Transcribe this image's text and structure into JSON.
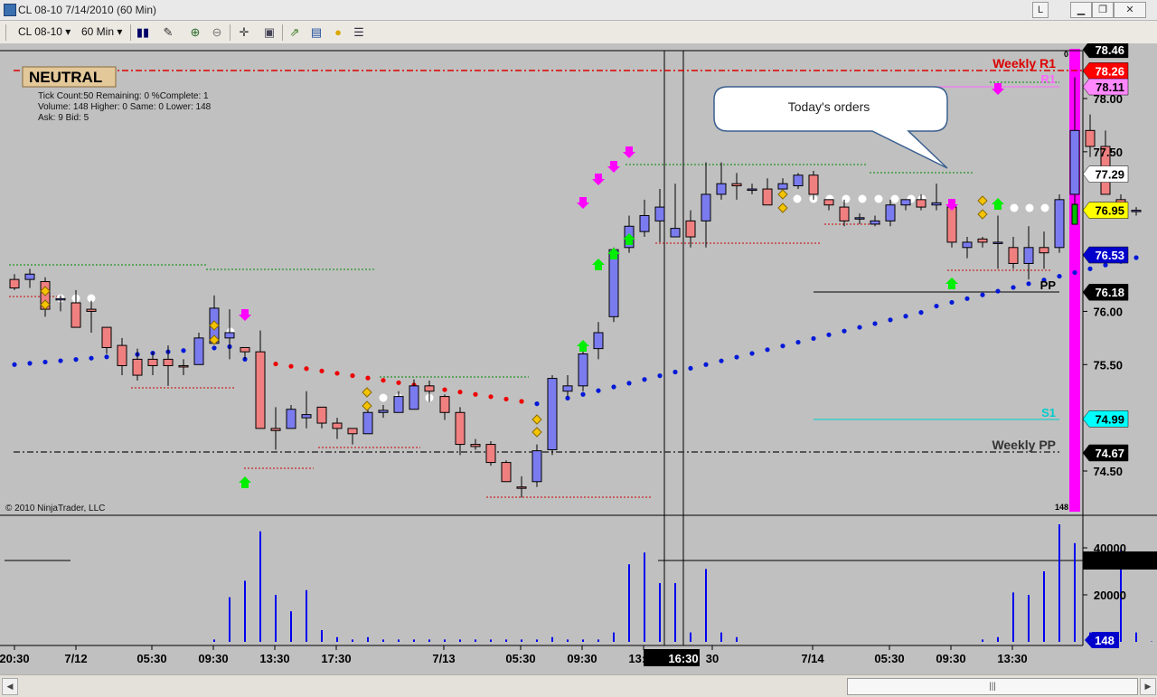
{
  "window": {
    "title": "CL 08-10  7/14/2010 (60 Min)",
    "l_label": "L",
    "min_label": "▁",
    "max_label": "❐",
    "close_label": "✕"
  },
  "toolbar": {
    "instrument": "CL 08-10",
    "interval": "60 Min",
    "icons": [
      "candle-style-icon",
      "pencil-icon",
      "zoom-in-icon",
      "zoom-out-icon",
      "crosshair-icon",
      "snapshot-icon",
      "strategy-icon",
      "indicator-icon",
      "currency-icon",
      "data-box-icon"
    ]
  },
  "chart": {
    "status_label": "NEUTRAL",
    "info_lines": [
      "Tick Count:50   Remaining: 0   %Complete: 1",
      "Volume: 148   Higher: 0   Same: 0   Lower: 148",
      "Ask: 9   Bid: 5"
    ],
    "copyright": "© 2010 NinjaTrader, LLC",
    "callout_text": "Today's orders",
    "label_weekly_r1": "Weekly R1",
    "label_r1": "R1",
    "label_pp": "PP",
    "label_s1": "S1",
    "label_weekly_pp": "Weekly PP",
    "corner_zero": "0",
    "corner_count": "148",
    "y_ticks": [
      {
        "label": "78.00",
        "price": 78.0
      },
      {
        "label": "77.50",
        "price": 77.5
      },
      {
        "label": "76.00",
        "price": 76.0
      },
      {
        "label": "75.50",
        "price": 75.5
      },
      {
        "label": "74.50",
        "price": 74.5
      }
    ],
    "price_badges": [
      {
        "label": "78.46",
        "price": 78.46,
        "bg": "#000000",
        "fg": "#ffffff"
      },
      {
        "label": "78.26",
        "price": 78.26,
        "bg": "#ff0000",
        "fg": "#ffffff"
      },
      {
        "label": "78.11",
        "price": 78.11,
        "bg": "#ff88ff",
        "fg": "#000000"
      },
      {
        "label": "77.29",
        "price": 77.29,
        "bg": "#ffffff",
        "fg": "#000000"
      },
      {
        "label": "76.95",
        "price": 76.95,
        "bg": "#ffff00",
        "fg": "#000000"
      },
      {
        "label": "76.53",
        "price": 76.53,
        "bg": "#0000cc",
        "fg": "#ffffff"
      },
      {
        "label": "76.18",
        "price": 76.18,
        "bg": "#000000",
        "fg": "#ffffff"
      },
      {
        "label": "74.99",
        "price": 74.99,
        "bg": "#00ffff",
        "fg": "#000000"
      },
      {
        "label": "74.67",
        "price": 74.67,
        "bg": "#000000",
        "fg": "#ffffff"
      }
    ],
    "vol_ticks": [
      {
        "label": "40000",
        "value": 40000
      },
      {
        "label": "20000",
        "value": 20000
      }
    ],
    "vol_badge": "148",
    "x_ticks": [
      {
        "label": "20:30",
        "x": 16
      },
      {
        "label": "7/12",
        "x": 84
      },
      {
        "label": "05:30",
        "x": 168
      },
      {
        "label": "09:30",
        "x": 236
      },
      {
        "label": "13:30",
        "x": 304
      },
      {
        "label": "17:30",
        "x": 372
      },
      {
        "label": "7/13",
        "x": 491
      },
      {
        "label": "05:30",
        "x": 576
      },
      {
        "label": "09:30",
        "x": 644
      },
      {
        "label": "13:30",
        "x": 712
      },
      {
        "label": "30",
        "x": 788
      },
      {
        "label": "7/14",
        "x": 899
      },
      {
        "label": "05:30",
        "x": 984
      },
      {
        "label": "09:30",
        "x": 1052
      },
      {
        "label": "13:30",
        "x": 1120
      }
    ],
    "x_cursor_label": "16:30"
  },
  "colors": {
    "chart_bg": "#c0c0c0",
    "up_candle": "#7b7bf0",
    "down_candle": "#f08080",
    "pp_dots_blue": "#0018d8",
    "pp_dots_red": "#ee0000",
    "magenta": "#ff00ff",
    "green": "#00ee00",
    "volume_bar": "#0000ee"
  },
  "chart_data": {
    "type": "candlestick",
    "instrument": "CL 08-10",
    "interval": "60 Min",
    "candles": [
      [
        76.3,
        76.35,
        76.2,
        76.22
      ],
      [
        76.3,
        76.4,
        76.22,
        76.35
      ],
      [
        76.28,
        76.32,
        75.95,
        76.02
      ],
      [
        76.12,
        76.15,
        76.0,
        76.12
      ],
      [
        76.08,
        76.2,
        75.88,
        75.85
      ],
      [
        76.02,
        76.1,
        75.8,
        76.0
      ],
      [
        75.85,
        75.85,
        75.6,
        75.66
      ],
      [
        75.68,
        75.75,
        75.4,
        75.49
      ],
      [
        75.55,
        75.65,
        75.35,
        75.4
      ],
      [
        75.55,
        75.62,
        75.4,
        75.49
      ],
      [
        75.55,
        75.68,
        75.3,
        75.49
      ],
      [
        75.49,
        75.55,
        75.4,
        75.48
      ],
      [
        75.5,
        75.8,
        75.5,
        75.75
      ],
      [
        75.7,
        76.15,
        75.7,
        76.03
      ],
      [
        75.75,
        76.02,
        75.55,
        75.8
      ],
      [
        75.66,
        75.66,
        75.55,
        75.62
      ],
      [
        75.62,
        75.82,
        75.3,
        74.9
      ],
      [
        74.9,
        75.1,
        74.7,
        74.88
      ],
      [
        74.9,
        75.12,
        74.9,
        75.08
      ],
      [
        75.0,
        75.25,
        74.9,
        75.03
      ],
      [
        75.1,
        75.1,
        74.9,
        74.95
      ],
      [
        74.95,
        75.0,
        74.8,
        74.9
      ],
      [
        74.9,
        74.9,
        74.75,
        74.85
      ],
      [
        74.85,
        75.1,
        74.85,
        75.05
      ],
      [
        75.05,
        75.12,
        75.0,
        75.07
      ],
      [
        75.05,
        75.25,
        75.05,
        75.2
      ],
      [
        75.08,
        75.36,
        75.08,
        75.3
      ],
      [
        75.3,
        75.35,
        75.15,
        75.25
      ],
      [
        75.2,
        75.22,
        74.98,
        75.05
      ],
      [
        75.05,
        75.1,
        74.65,
        74.75
      ],
      [
        74.75,
        74.8,
        74.7,
        74.73
      ],
      [
        74.75,
        74.78,
        74.55,
        74.58
      ],
      [
        74.58,
        74.6,
        74.4,
        74.4
      ],
      [
        74.35,
        74.45,
        74.25,
        74.34
      ],
      [
        74.4,
        74.75,
        74.35,
        74.69
      ],
      [
        74.7,
        75.4,
        74.65,
        75.37
      ],
      [
        75.25,
        75.4,
        75.2,
        75.3
      ],
      [
        75.3,
        75.65,
        75.25,
        75.6
      ],
      [
        75.65,
        75.9,
        75.55,
        75.8
      ],
      [
        75.95,
        76.6,
        75.9,
        76.58
      ],
      [
        76.6,
        76.9,
        76.55,
        76.8
      ],
      [
        76.75,
        77.05,
        76.7,
        76.9
      ],
      [
        76.85,
        77.15,
        76.65,
        76.98
      ],
      [
        76.7,
        77.2,
        76.7,
        76.78
      ],
      [
        76.85,
        76.95,
        76.6,
        76.7
      ],
      [
        76.85,
        77.4,
        76.6,
        77.1
      ],
      [
        77.1,
        77.4,
        77.05,
        77.2
      ],
      [
        77.2,
        77.3,
        77.05,
        77.18
      ],
      [
        77.14,
        77.2,
        77.1,
        77.15
      ],
      [
        77.15,
        77.25,
        77.0,
        77.0
      ],
      [
        77.15,
        77.25,
        77.15,
        77.2
      ],
      [
        77.18,
        77.3,
        77.15,
        77.28
      ],
      [
        77.28,
        77.32,
        77.05,
        77.1
      ],
      [
        77.05,
        77.05,
        76.95,
        77.0
      ],
      [
        76.98,
        77.05,
        76.8,
        76.85
      ],
      [
        76.88,
        76.92,
        76.82,
        76.88
      ],
      [
        76.82,
        76.9,
        76.8,
        76.85
      ],
      [
        76.85,
        77.05,
        76.8,
        77.0
      ],
      [
        77.0,
        77.05,
        76.95,
        77.05
      ],
      [
        77.05,
        77.1,
        76.95,
        76.98
      ],
      [
        77.0,
        77.2,
        76.95,
        77.02
      ],
      [
        76.98,
        77.02,
        76.6,
        76.65
      ],
      [
        76.6,
        76.7,
        76.5,
        76.65
      ],
      [
        76.68,
        76.7,
        76.6,
        76.65
      ],
      [
        76.65,
        76.9,
        76.4,
        76.65
      ],
      [
        76.6,
        76.7,
        76.4,
        76.45
      ],
      [
        76.45,
        76.8,
        76.3,
        76.6
      ],
      [
        76.6,
        76.75,
        76.4,
        76.55
      ],
      [
        76.6,
        77.1,
        76.55,
        77.05
      ],
      [
        77.1,
        78.2,
        77.0,
        77.7
      ],
      [
        77.7,
        77.85,
        77.45,
        77.55
      ],
      [
        77.55,
        77.7,
        77.1,
        77.1
      ],
      [
        77.05,
        77.1,
        76.9,
        76.95
      ],
      [
        76.95,
        76.98,
        76.9,
        76.95
      ]
    ],
    "volume": [
      0,
      0,
      0,
      0,
      0,
      0,
      0,
      0,
      0,
      0,
      0,
      0,
      0,
      1000,
      19000,
      26000,
      47000,
      20000,
      13000,
      22000,
      5000,
      2000,
      1000,
      2000,
      1000,
      1000,
      1000,
      1000,
      1000,
      1000,
      1000,
      1000,
      1000,
      1000,
      1000,
      2000,
      1000,
      1000,
      1000,
      4000,
      33000,
      38000,
      25000,
      25000,
      4000,
      31000,
      4000,
      2000,
      0,
      0,
      0,
      0,
      0,
      0,
      0,
      0,
      0,
      0,
      0,
      0,
      0,
      0,
      0,
      1000,
      2000,
      21000,
      20000,
      30000,
      50000,
      42000,
      4000,
      2000,
      39000,
      4000,
      148
    ],
    "pivot_levels": {
      "Weekly R1": 78.26,
      "R1": 78.11,
      "PP": 76.18,
      "S1": 74.99,
      "Weekly PP": 74.67
    },
    "last_price": 76.95,
    "ylim": [
      74.2,
      78.46
    ],
    "x_labels": [
      "20:30",
      "7/12",
      "05:30",
      "09:30",
      "13:30",
      "17:30",
      "7/13",
      "05:30",
      "09:30",
      "13:30",
      "16:30",
      "30",
      "7/14",
      "05:30",
      "09:30",
      "13:30"
    ]
  }
}
